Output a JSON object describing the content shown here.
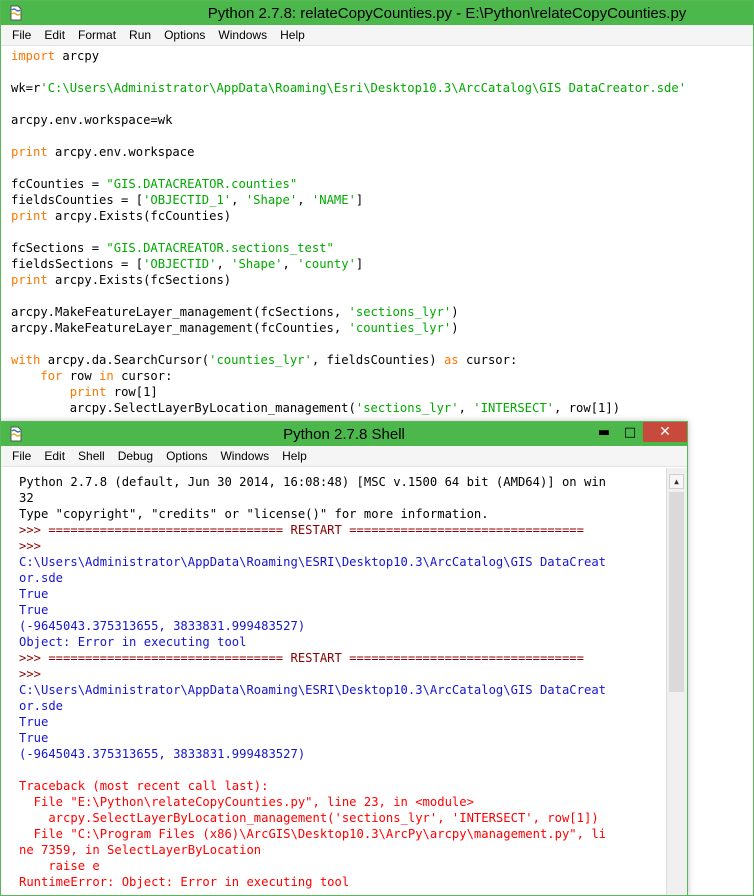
{
  "editor": {
    "title": "Python 2.7.8: relateCopyCounties.py - E:\\Python\\relateCopyCounties.py",
    "menus": [
      "File",
      "Edit",
      "Format",
      "Run",
      "Options",
      "Windows",
      "Help"
    ],
    "code_lines": [
      [
        {
          "t": "import",
          "c": "kw"
        },
        {
          "t": " arcpy",
          "c": ""
        }
      ],
      [],
      [
        {
          "t": "wk=r",
          "c": ""
        },
        {
          "t": "'C:\\Users\\Administrator\\AppData\\Roaming\\Esri\\Desktop10.3\\ArcCatalog\\GIS DataCreator.sde'",
          "c": "st"
        }
      ],
      [],
      [
        {
          "t": "arcpy.env.workspace=wk",
          "c": ""
        }
      ],
      [],
      [
        {
          "t": "print",
          "c": "kw"
        },
        {
          "t": " arcpy.env.workspace",
          "c": ""
        }
      ],
      [],
      [
        {
          "t": "fcCounties = ",
          "c": ""
        },
        {
          "t": "\"GIS.DATACREATOR.counties\"",
          "c": "st"
        }
      ],
      [
        {
          "t": "fieldsCounties = [",
          "c": ""
        },
        {
          "t": "'OBJECTID_1'",
          "c": "st"
        },
        {
          "t": ", ",
          "c": ""
        },
        {
          "t": "'Shape'",
          "c": "st"
        },
        {
          "t": ", ",
          "c": ""
        },
        {
          "t": "'NAME'",
          "c": "st"
        },
        {
          "t": "]",
          "c": ""
        }
      ],
      [
        {
          "t": "print",
          "c": "kw"
        },
        {
          "t": " arcpy.Exists(fcCounties)",
          "c": ""
        }
      ],
      [],
      [
        {
          "t": "fcSections = ",
          "c": ""
        },
        {
          "t": "\"GIS.DATACREATOR.sections_test\"",
          "c": "st"
        }
      ],
      [
        {
          "t": "fieldsSections = [",
          "c": ""
        },
        {
          "t": "'OBJECTID'",
          "c": "st"
        },
        {
          "t": ", ",
          "c": ""
        },
        {
          "t": "'Shape'",
          "c": "st"
        },
        {
          "t": ", ",
          "c": ""
        },
        {
          "t": "'county'",
          "c": "st"
        },
        {
          "t": "]",
          "c": ""
        }
      ],
      [
        {
          "t": "print",
          "c": "kw"
        },
        {
          "t": " arcpy.Exists(fcSections)",
          "c": ""
        }
      ],
      [],
      [
        {
          "t": "arcpy.MakeFeatureLayer_management(fcSections, ",
          "c": ""
        },
        {
          "t": "'sections_lyr'",
          "c": "st"
        },
        {
          "t": ")",
          "c": ""
        }
      ],
      [
        {
          "t": "arcpy.MakeFeatureLayer_management(fcCounties, ",
          "c": ""
        },
        {
          "t": "'counties_lyr'",
          "c": "st"
        },
        {
          "t": ")",
          "c": ""
        }
      ],
      [],
      [
        {
          "t": "with",
          "c": "kw"
        },
        {
          "t": " arcpy.da.SearchCursor(",
          "c": ""
        },
        {
          "t": "'counties_lyr'",
          "c": "st"
        },
        {
          "t": ", fieldsCounties) ",
          "c": ""
        },
        {
          "t": "as",
          "c": "kw"
        },
        {
          "t": " cursor:",
          "c": ""
        }
      ],
      [
        {
          "t": "    ",
          "c": ""
        },
        {
          "t": "for",
          "c": "kw"
        },
        {
          "t": " row ",
          "c": ""
        },
        {
          "t": "in",
          "c": "kw"
        },
        {
          "t": " cursor:",
          "c": ""
        }
      ],
      [
        {
          "t": "        ",
          "c": ""
        },
        {
          "t": "print",
          "c": "kw"
        },
        {
          "t": " row[1]",
          "c": ""
        }
      ],
      [
        {
          "t": "        arcpy.SelectLayerByLocation_management(",
          "c": ""
        },
        {
          "t": "'sections_lyr'",
          "c": "st"
        },
        {
          "t": ", ",
          "c": ""
        },
        {
          "t": "'INTERSECT'",
          "c": "st"
        },
        {
          "t": ", row[1])",
          "c": ""
        }
      ]
    ]
  },
  "shell": {
    "title": "Python 2.7.8 Shell",
    "menus": [
      "File",
      "Edit",
      "Shell",
      "Debug",
      "Options",
      "Windows",
      "Help"
    ],
    "buttons": {
      "minimize": "▬",
      "maximize": "□",
      "close": "✕"
    },
    "lines": [
      {
        "t": "Python 2.7.8 (default, Jun 30 2014, 16:08:48) [MSC v.1500 64 bit (AMD64)] on win",
        "c": "c-black"
      },
      {
        "t": "32",
        "c": "c-black"
      },
      {
        "t": "Type \"copyright\", \"credits\" or \"license()\" for more information.",
        "c": "c-black"
      },
      {
        "t": ">>> ================================ RESTART ================================",
        "c": "c-maroon"
      },
      {
        "t": ">>>",
        "c": "c-maroon"
      },
      {
        "t": "C:\\Users\\Administrator\\AppData\\Roaming\\ESRI\\Desktop10.3\\ArcCatalog\\GIS DataCreat",
        "c": "c-blue"
      },
      {
        "t": "or.sde",
        "c": "c-blue"
      },
      {
        "t": "True",
        "c": "c-blue"
      },
      {
        "t": "True",
        "c": "c-blue"
      },
      {
        "t": "(-9645043.375313655, 3833831.999483527)",
        "c": "c-blue"
      },
      {
        "t": "Object: Error in executing tool",
        "c": "c-blue"
      },
      {
        "t": ">>> ================================ RESTART ================================",
        "c": "c-maroon"
      },
      {
        "t": ">>>",
        "c": "c-maroon"
      },
      {
        "t": "C:\\Users\\Administrator\\AppData\\Roaming\\ESRI\\Desktop10.3\\ArcCatalog\\GIS DataCreat",
        "c": "c-blue"
      },
      {
        "t": "or.sde",
        "c": "c-blue"
      },
      {
        "t": "True",
        "c": "c-blue"
      },
      {
        "t": "True",
        "c": "c-blue"
      },
      {
        "t": "(-9645043.375313655, 3833831.999483527)",
        "c": "c-blue"
      },
      {
        "t": "",
        "c": "c-black"
      },
      {
        "t": "Traceback (most recent call last):",
        "c": "c-red"
      },
      {
        "t": "  File \"E:\\Python\\relateCopyCounties.py\", line 23, in <module>",
        "c": "c-red"
      },
      {
        "t": "    arcpy.SelectLayerByLocation_management('sections_lyr', 'INTERSECT', row[1])",
        "c": "c-red"
      },
      {
        "t": "  File \"C:\\Program Files (x86)\\ArcGIS\\Desktop10.3\\ArcPy\\arcpy\\management.py\", li",
        "c": "c-red"
      },
      {
        "t": "ne 7359, in SelectLayerByLocation",
        "c": "c-red"
      },
      {
        "t": "    raise e",
        "c": "c-red"
      },
      {
        "t": "RuntimeError: Object: Error in executing tool",
        "c": "c-red"
      }
    ]
  }
}
